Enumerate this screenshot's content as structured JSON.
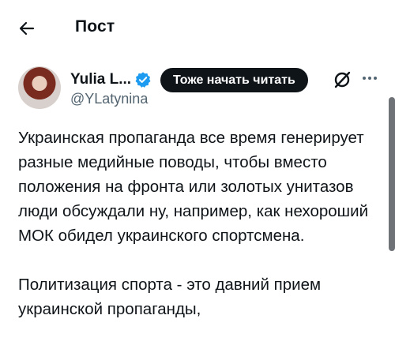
{
  "header": {
    "back_icon": "arrow-left-icon",
    "title": "Пост"
  },
  "author": {
    "display_name": "Yulia L...",
    "handle": "@YLatynina",
    "verified_icon": "verified-badge-icon",
    "verified_color": "#1d9bf0"
  },
  "actions": {
    "follow_label": "Тоже начать читать",
    "grok_icon": "grok-icon",
    "more_icon": "more-horizontal-icon"
  },
  "post": {
    "paragraphs": [
      "Украинская пропаганда все время генерирует разные медийные поводы, чтобы вместо положения на фронта или золотых унитазов люди обсуждали ну, например, как нехороший МОК обидел украинского спортсмена.",
      "Политизация спорта - это давний прием украинской пропаганды,"
    ]
  },
  "colors": {
    "text": "#0f1419",
    "secondary": "#536471",
    "button_bg": "#0f1419",
    "button_text": "#ffffff"
  }
}
